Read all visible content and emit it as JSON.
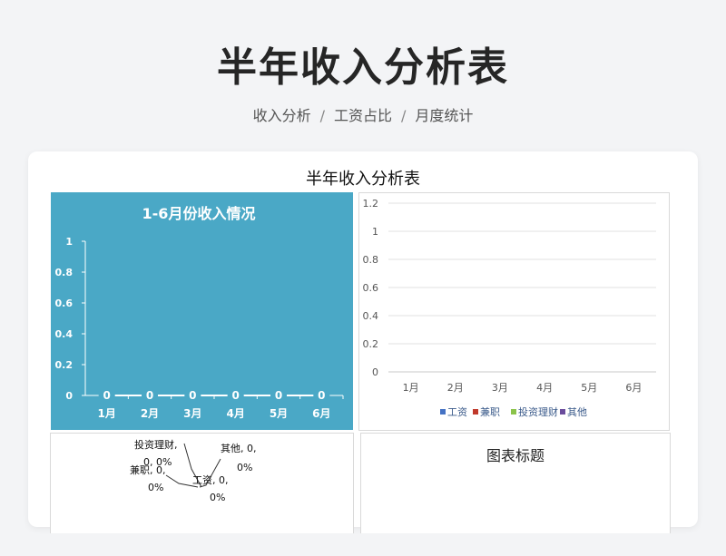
{
  "page": {
    "title": "半年收入分析表",
    "breadcrumb": [
      "收入分析",
      "工资占比",
      "月度统计"
    ],
    "sheet_title": "半年收入分析表"
  },
  "colors": {
    "teal_bg": "#4aa8c6",
    "grid": "#e0e0e0",
    "series": [
      "#4472c4",
      "#c0392b",
      "#8bc34a",
      "#6a4c9c"
    ]
  },
  "chart_data": [
    {
      "type": "line",
      "title": "1-6月份收入情况",
      "categories": [
        "1月",
        "2月",
        "3月",
        "4月",
        "5月",
        "6月"
      ],
      "values": [
        0,
        0,
        0,
        0,
        0,
        0
      ],
      "data_labels": [
        "0",
        "0",
        "0",
        "0",
        "0",
        "0"
      ],
      "ylim": [
        0,
        1
      ],
      "yticks": [
        "0",
        "0.2",
        "0.4",
        "0.6",
        "0.8",
        "1"
      ],
      "xlabel": "",
      "ylabel": ""
    },
    {
      "type": "bar",
      "title": "",
      "categories": [
        "1月",
        "2月",
        "3月",
        "4月",
        "5月",
        "6月"
      ],
      "series": [
        {
          "name": "工资",
          "values": [
            0,
            0,
            0,
            0,
            0,
            0
          ]
        },
        {
          "name": "兼职",
          "values": [
            0,
            0,
            0,
            0,
            0,
            0
          ]
        },
        {
          "name": "投资理财",
          "values": [
            0,
            0,
            0,
            0,
            0,
            0
          ]
        },
        {
          "name": "其他",
          "values": [
            0,
            0,
            0,
            0,
            0,
            0
          ]
        }
      ],
      "ylim": [
        0,
        1.2
      ],
      "yticks": [
        "0",
        "0.2",
        "0.4",
        "0.6",
        "0.8",
        "1",
        "1.2"
      ],
      "legend": "bottom",
      "grid": true
    },
    {
      "type": "pie",
      "title": "",
      "slices": [
        {
          "name": "投资理财",
          "value": 0,
          "pct": "0%",
          "label_a": "投资理财,",
          "label_b": "0, 0%"
        },
        {
          "name": "其他",
          "value": 0,
          "pct": "0%",
          "label_a": "其他, 0,",
          "label_b": "0%"
        },
        {
          "name": "兼职",
          "value": 0,
          "pct": "0%",
          "label_a": "兼职, 0,",
          "label_b": "0%"
        },
        {
          "name": "工资",
          "value": 0,
          "pct": "0%",
          "label_a": "工资, 0,",
          "label_b": "0%"
        }
      ]
    },
    {
      "type": "bar",
      "title": "图表标题",
      "series": []
    }
  ]
}
